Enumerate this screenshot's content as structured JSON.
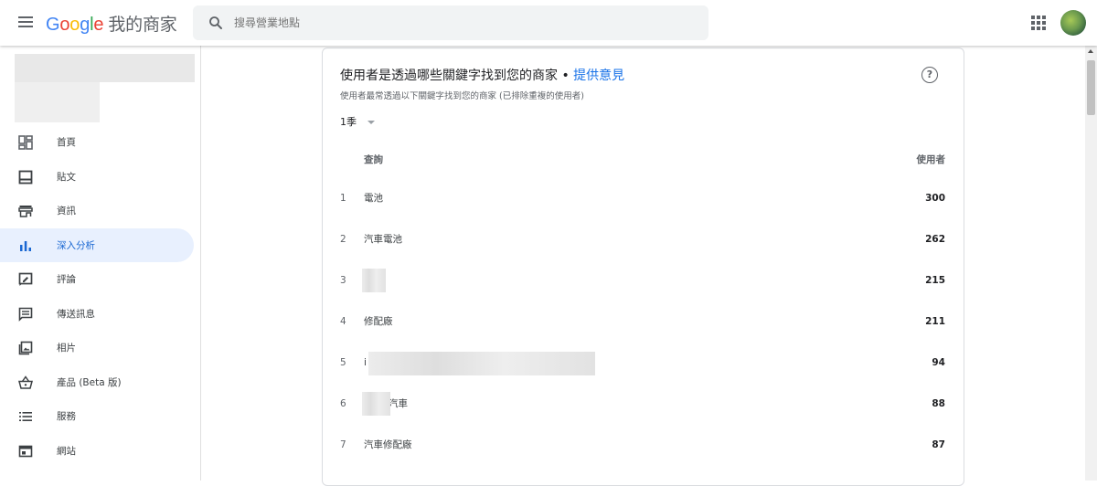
{
  "header": {
    "logo_letters": [
      "G",
      "o",
      "o",
      "g",
      "l",
      "e"
    ],
    "product_name": "我的商家",
    "search_placeholder": "搜尋營業地點"
  },
  "sidebar": {
    "items": [
      {
        "label": "首頁",
        "icon": "dashboard-icon",
        "active": false
      },
      {
        "label": "貼文",
        "icon": "posts-icon",
        "active": false
      },
      {
        "label": "資訊",
        "icon": "storefront-icon",
        "active": false
      },
      {
        "label": "深入分析",
        "icon": "insights-bar-chart-icon",
        "active": true
      },
      {
        "label": "評論",
        "icon": "reviews-icon",
        "active": false
      },
      {
        "label": "傳送訊息",
        "icon": "messaging-icon",
        "active": false
      },
      {
        "label": "相片",
        "icon": "photos-icon",
        "active": false
      },
      {
        "label": "產品 (Beta 版)",
        "icon": "shopping-basket-icon",
        "active": false
      },
      {
        "label": "服務",
        "icon": "list-icon",
        "active": false
      },
      {
        "label": "網站",
        "icon": "website-icon",
        "active": false
      }
    ]
  },
  "card": {
    "title": "使用者是透過哪些關鍵字找到您的商家",
    "separator": " • ",
    "feedback_link": "提供意見",
    "subtitle": "使用者最常透過以下關鍵字找到您的商家 (已排除重複的使用者)",
    "period": "1季",
    "help_glyph": "?",
    "columns": {
      "query": "查詢",
      "users": "使用者"
    },
    "rows": [
      {
        "rank": "1",
        "query": "電池",
        "users": "300"
      },
      {
        "rank": "2",
        "query": "汽車電池",
        "users": "262"
      },
      {
        "rank": "3",
        "query": "",
        "users": "215"
      },
      {
        "rank": "4",
        "query": "修配廠",
        "users": "211"
      },
      {
        "rank": "5",
        "query": "i",
        "users": "94"
      },
      {
        "rank": "6",
        "query": "汽車",
        "users": "88"
      },
      {
        "rank": "7",
        "query": "汽車修配廠",
        "users": "87"
      }
    ]
  },
  "colors": {
    "accent": "#1a73e8",
    "active_bg": "#e8f0fe",
    "active_text": "#1967d2"
  }
}
